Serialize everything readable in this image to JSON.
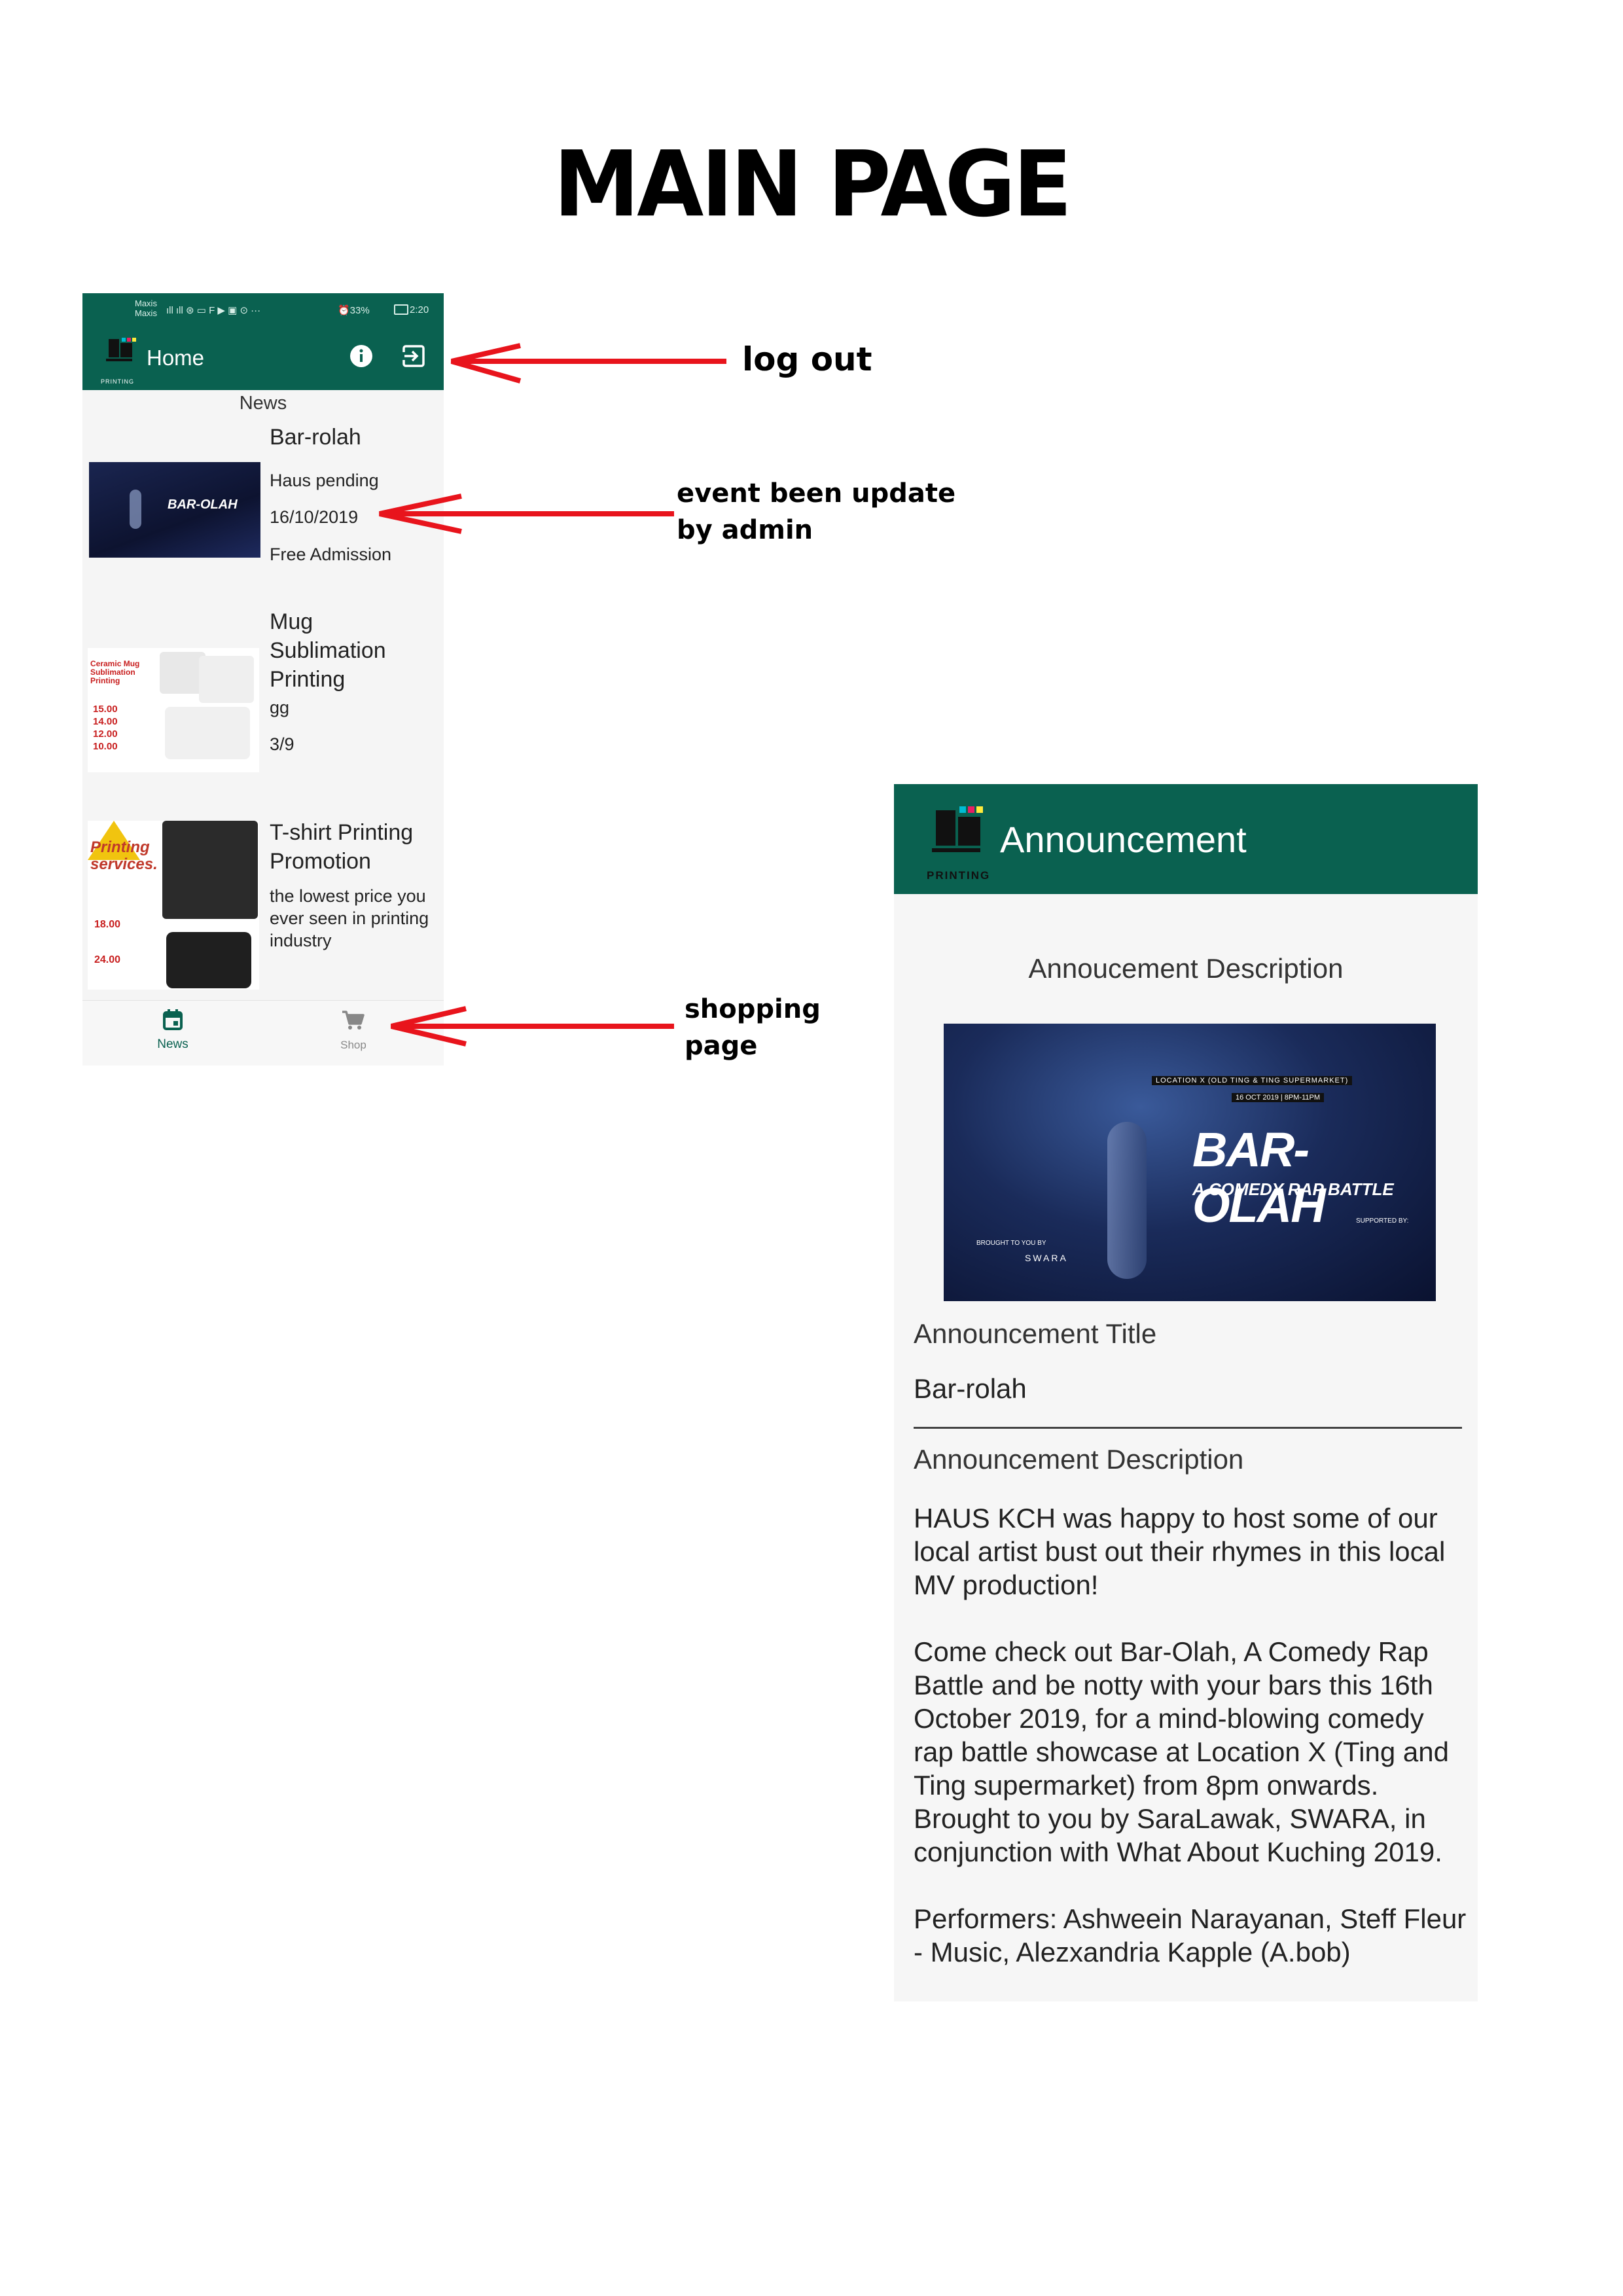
{
  "page": {
    "title": "MAIN PAGE"
  },
  "phone": {
    "status": {
      "carrier_top": "Maxis",
      "carrier_bottom": "Maxis",
      "icons_left": "ıll ıll ⊛ ▭ F ▶ ▣ ⊙ ···",
      "battery": "⏰33%",
      "time": "2:20"
    },
    "appbar": {
      "logo_caption": "PRINTING",
      "title": "Home"
    },
    "section_label": "News",
    "cards": [
      {
        "title": "Bar-rolah",
        "lines": [
          "Haus pending",
          "16/10/2019",
          "Free Admission"
        ],
        "poster_text": "BAR-OLAH"
      },
      {
        "title": "Mug\nSublimation\nPrinting",
        "lines": [
          "gg",
          "3/9"
        ],
        "prices": [
          "15.00",
          "14.00",
          "12.00",
          "10.00"
        ],
        "poster_text": "Ceramic Mug Sublimation Printing"
      },
      {
        "title": "T-shirt Printing\nPromotion",
        "lines": [
          "the lowest price you",
          "ever seen in printing",
          "industry"
        ],
        "prices": [
          "18.00",
          "24.00"
        ],
        "poster_text": "Printing services."
      }
    ],
    "bottom_nav": [
      {
        "label": "News",
        "icon": "calendar-icon",
        "active": true
      },
      {
        "label": "Shop",
        "icon": "cart-icon",
        "active": false
      }
    ]
  },
  "annotations": [
    {
      "text": "log out"
    },
    {
      "text": "event been update\nby admin"
    },
    {
      "text": "shopping\npage"
    }
  ],
  "announcement": {
    "header_title": "Announcement",
    "logo_caption": "PRINTING",
    "subtitle": "Annoucement Description",
    "poster": {
      "headline": "BAR-OLAH",
      "tagline": "A COMEDY RAP BATTLE",
      "location": "LOCATION X (OLD TING & TING SUPERMARKET)",
      "date": "16 OCT 2019 | 8PM-11PM",
      "brought": "BROUGHT TO YOU BY",
      "sponsor": "SWARA",
      "supported": "SUPPORTED BY:"
    },
    "title_label": "Announcement Title",
    "title_value": "Bar-rolah",
    "desc_label": "Announcement Description",
    "description": "HAUS KCH was happy to host some of our local artist bust out their rhymes in this local MV production!\n\nCome check out Bar-Olah, A Comedy Rap Battle and be notty with your bars this 16th October 2019, for a mind-blowing comedy rap battle showcase at Location X (Ting and Ting supermarket) from 8pm onwards. Brought to you by SaraLawak, SWARA,  in conjunction with What About Kuching 2019.\n\nPerformers: Ashweein Narayanan, Steff Fleur - Music, Alezxandria Kapple (A.bob)"
  },
  "colors": {
    "primary": "#0a6150",
    "arrow": "#e8141c",
    "accent_active": "#0a6150"
  }
}
